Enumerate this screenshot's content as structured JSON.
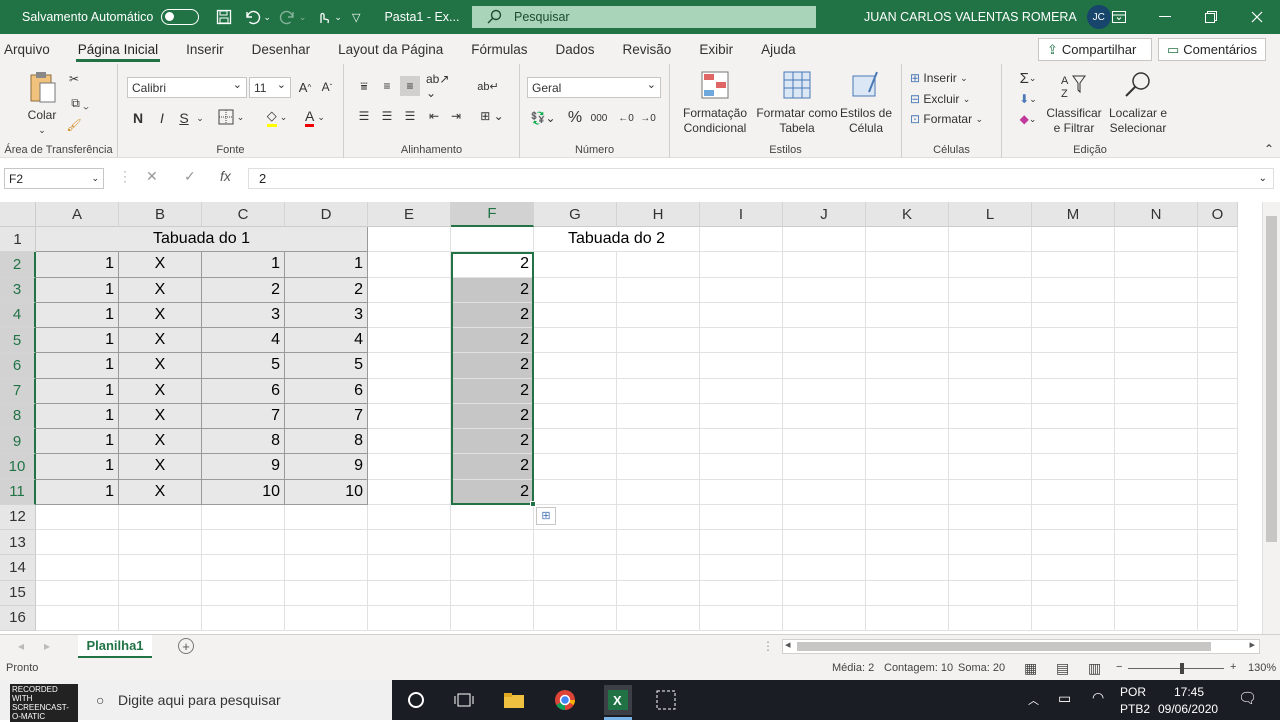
{
  "titlebar": {
    "autosave_label": "Salvamento Automático",
    "filename": "Pasta1  -  Ex...",
    "search_placeholder": "Pesquisar",
    "user_name": "JUAN CARLOS VALENTAS ROMERA",
    "user_initials": "JC"
  },
  "menu": {
    "items": [
      "Arquivo",
      "Página Inicial",
      "Inserir",
      "Desenhar",
      "Layout da Página",
      "Fórmulas",
      "Dados",
      "Revisão",
      "Exibir",
      "Ajuda"
    ],
    "share_label": "Compartilhar",
    "comments_label": "Comentários"
  },
  "ribbon": {
    "clipboard": {
      "paste": "Colar",
      "label": "Área de Transferência"
    },
    "font": {
      "name": "Calibri",
      "size": "11",
      "bold": "N",
      "italic": "I",
      "underline": "S",
      "grow": "A^",
      "shrink": "A˅",
      "label": "Fonte"
    },
    "alignment": {
      "label": "Alinhamento"
    },
    "number": {
      "format": "Geral",
      "percent": "%",
      "thousands": "000",
      "label": "Número"
    },
    "styles": {
      "cond_format": "Formatação Condicional",
      "format_table": "Formatar como Tabela",
      "cell_styles": "Estilos de Célula",
      "label": "Estilos"
    },
    "cells": {
      "insert": "Inserir",
      "delete": "Excluir",
      "format": "Formatar",
      "label": "Células"
    },
    "editing": {
      "sort": "Classificar e Filtrar",
      "find": "Localizar e Selecionar",
      "label": "Edição"
    }
  },
  "formula_bar": {
    "name_box": "F2",
    "fx": "fx",
    "content": "2"
  },
  "columns": [
    "A",
    "B",
    "C",
    "D",
    "E",
    "F",
    "G",
    "H",
    "I",
    "J",
    "K",
    "L",
    "M",
    "N",
    "O"
  ],
  "rows": [
    "1",
    "2",
    "3",
    "4",
    "5",
    "6",
    "7",
    "8",
    "9",
    "10",
    "11",
    "12",
    "13",
    "14",
    "15",
    "16"
  ],
  "table1": {
    "title": "Tabuada do 1",
    "rows": [
      [
        "1",
        "X",
        "1",
        "1"
      ],
      [
        "1",
        "X",
        "2",
        "2"
      ],
      [
        "1",
        "X",
        "3",
        "3"
      ],
      [
        "1",
        "X",
        "4",
        "4"
      ],
      [
        "1",
        "X",
        "5",
        "5"
      ],
      [
        "1",
        "X",
        "6",
        "6"
      ],
      [
        "1",
        "X",
        "7",
        "7"
      ],
      [
        "1",
        "X",
        "8",
        "8"
      ],
      [
        "1",
        "X",
        "9",
        "9"
      ],
      [
        "1",
        "X",
        "10",
        "10"
      ]
    ]
  },
  "table2": {
    "title": "Tabuada do 2",
    "f_values": [
      "2",
      "2",
      "2",
      "2",
      "2",
      "2",
      "2",
      "2",
      "2",
      "2"
    ]
  },
  "sheet": {
    "tab": "Planilha1"
  },
  "status": {
    "ready": "Pronto",
    "average": "Média: 2",
    "count": "Contagem: 10",
    "sum": "Soma: 20",
    "zoom": "130%"
  },
  "taskbar": {
    "search_text": "Digite aqui para pesquisar",
    "recorder_text": "RECORDED WITH SCREENCAST-O-MATIC",
    "lang": "POR",
    "layout": "PTB2",
    "time": "17:45",
    "date": "09/06/2020"
  },
  "colors": {
    "excel_green": "#217346",
    "selection_gray": "#c6c6c6",
    "table_gray": "#e8e8e8"
  }
}
